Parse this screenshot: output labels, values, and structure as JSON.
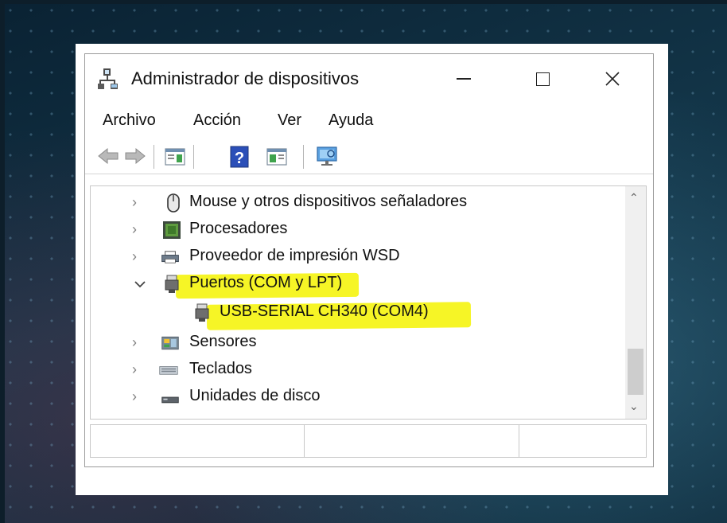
{
  "window": {
    "title": "Administrador de dispositivos",
    "menu": [
      "Archivo",
      "Acción",
      "Ver",
      "Ayuda"
    ]
  },
  "toolbar": {
    "icons": [
      "back-arrow-icon",
      "forward-arrow-icon",
      "properties-icon",
      "help-icon",
      "update-driver-icon",
      "scan-hardware-icon"
    ]
  },
  "tree": {
    "items": [
      {
        "label": "Mouse y otros dispositivos señaladores",
        "icon": "mouse-icon",
        "expanded": false
      },
      {
        "label": "Procesadores",
        "icon": "processor-icon",
        "expanded": false
      },
      {
        "label": "Proveedor de impresión WSD",
        "icon": "printer-icon",
        "expanded": false
      },
      {
        "label": "Puertos (COM y LPT)",
        "icon": "port-icon",
        "expanded": true,
        "highlighted": true
      },
      {
        "label": "USB-SERIAL CH340 (COM4)",
        "icon": "port-icon",
        "child": true,
        "highlighted": true
      },
      {
        "label": "Sensores",
        "icon": "sensor-icon",
        "expanded": false
      },
      {
        "label": "Teclados",
        "icon": "keyboard-icon",
        "expanded": false
      },
      {
        "label": "Unidades de disco",
        "icon": "disk-icon",
        "expanded": false
      }
    ]
  },
  "colors": {
    "highlight": "#f6f526",
    "background": "#0f2a3a"
  }
}
